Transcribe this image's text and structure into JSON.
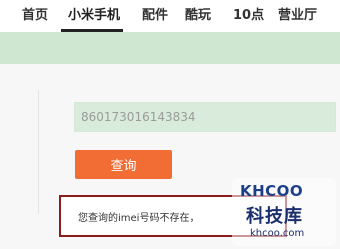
{
  "nav": {
    "items": [
      {
        "label": "首页"
      },
      {
        "label": "小米手机"
      },
      {
        "label": "配件"
      },
      {
        "label": "酷玩"
      },
      {
        "label": "10点"
      },
      {
        "label": "营业厅"
      }
    ]
  },
  "query_form": {
    "imei_value": "860173016143834",
    "button_label": "查询"
  },
  "result": {
    "message": "您查询的imei号码不存在，"
  },
  "watermark": {
    "logo": "KHCOO",
    "name": "科技库",
    "url": "khcoo.com"
  },
  "colors": {
    "accent": "#f26d33",
    "band": "#cfe7d1",
    "result_border": "#8a1c1c"
  }
}
